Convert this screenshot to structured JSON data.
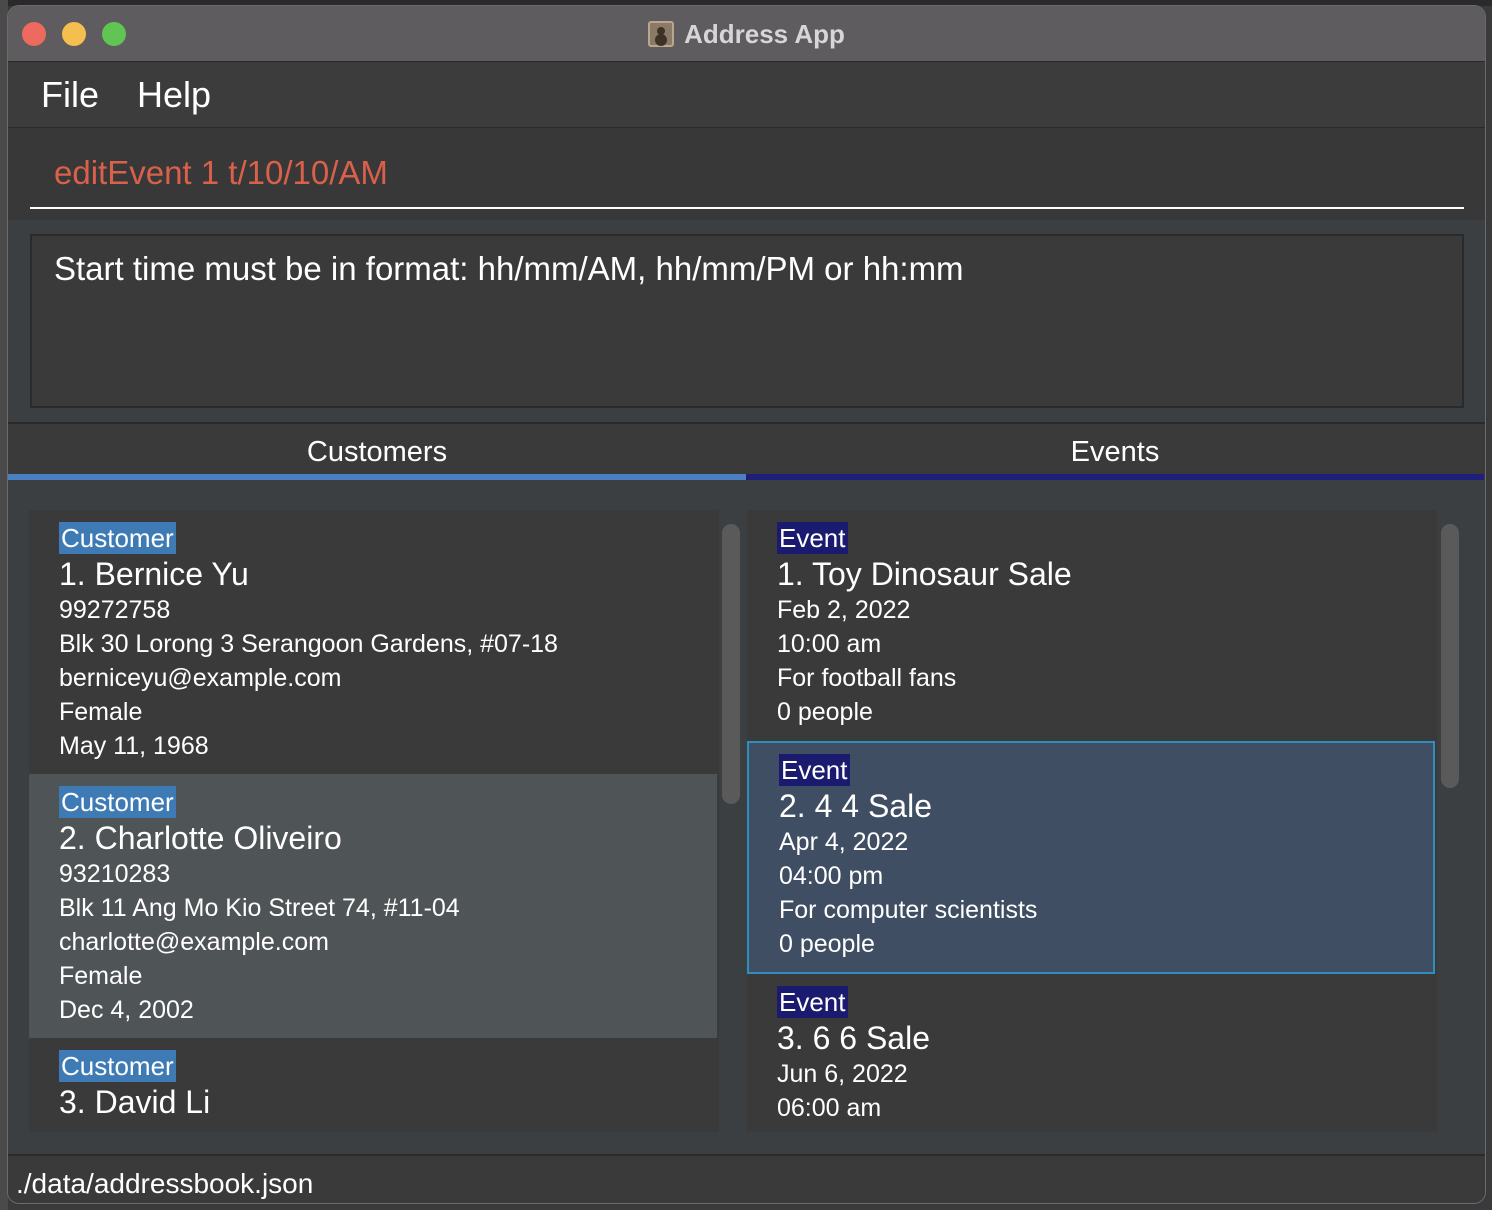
{
  "window": {
    "title": "Address App"
  },
  "menu": {
    "file": "File",
    "help": "Help"
  },
  "command": {
    "text": "editEvent 1 t/10/10/AM"
  },
  "result": {
    "text": "Start time must be in format: hh/mm/AM, hh/mm/PM or hh:mm"
  },
  "tabs": {
    "customers": "Customers",
    "events": "Events"
  },
  "customers": [
    {
      "tag": "Customer",
      "title": "1.  Bernice Yu",
      "phone": "99272758",
      "address": "Blk 30 Lorong 3 Serangoon Gardens, #07-18",
      "email": "berniceyu@example.com",
      "gender": "Female",
      "birthday": "May 11, 1968"
    },
    {
      "tag": "Customer",
      "title": "2.  Charlotte Oliveiro",
      "phone": "93210283",
      "address": "Blk 11 Ang Mo Kio Street 74, #11-04",
      "email": "charlotte@example.com",
      "gender": "Female",
      "birthday": "Dec 4, 2002"
    },
    {
      "tag": "Customer",
      "title": "3.  David Li"
    }
  ],
  "events": [
    {
      "tag": "Event",
      "title": "1.  Toy Dinosaur Sale",
      "date": "Feb 2, 2022",
      "time": "10:00 am",
      "description": "For football fans",
      "people": "0 people"
    },
    {
      "tag": "Event",
      "title": "2.  4 4 Sale",
      "date": "Apr 4, 2022",
      "time": "04:00 pm",
      "description": "For computer scientists",
      "people": "0 people"
    },
    {
      "tag": "Event",
      "title": "3.  6 6 Sale",
      "date": "Jun 6, 2022",
      "time": "06:00 am"
    }
  ],
  "status": {
    "path": "./data/addressbook.json"
  },
  "colors": {
    "command_error": "#d9604a",
    "customer_tag": "#3e7bb5",
    "event_tag": "#1a1a6e",
    "selection_border": "#2e8fbe"
  }
}
